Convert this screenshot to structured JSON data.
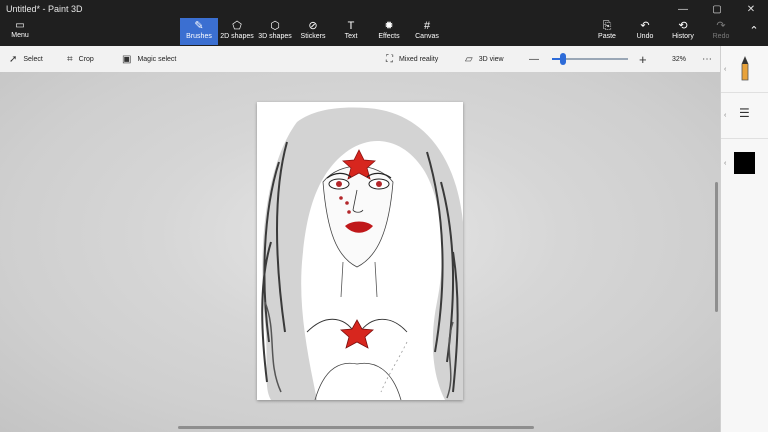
{
  "window": {
    "title": "Untitled* - Paint 3D",
    "controls": {
      "minimize": "—",
      "maximize": "▢",
      "close": "✕"
    }
  },
  "ribbon": {
    "menu_label": "Menu",
    "tools": [
      {
        "label": "Brushes",
        "icon": "brush-icon",
        "glyph": "✎",
        "active": true
      },
      {
        "label": "2D shapes",
        "icon": "2d-shapes-icon",
        "glyph": "⬠",
        "active": false
      },
      {
        "label": "3D shapes",
        "icon": "3d-shapes-icon",
        "glyph": "⬡",
        "active": false
      },
      {
        "label": "Stickers",
        "icon": "stickers-icon",
        "glyph": "⊘",
        "active": false
      },
      {
        "label": "Text",
        "icon": "text-icon",
        "glyph": "T",
        "active": false
      },
      {
        "label": "Effects",
        "icon": "effects-icon",
        "glyph": "✹",
        "active": false
      },
      {
        "label": "Canvas",
        "icon": "canvas-icon",
        "glyph": "#",
        "active": false
      }
    ],
    "actions": [
      {
        "label": "Paste",
        "icon": "paste-icon",
        "glyph": "📋",
        "enabled": true
      },
      {
        "label": "Undo",
        "icon": "undo-icon",
        "glyph": "↶",
        "enabled": true
      },
      {
        "label": "History",
        "icon": "history-icon",
        "glyph": "⟲",
        "enabled": true
      },
      {
        "label": "Redo",
        "icon": "redo-icon",
        "glyph": "↷",
        "enabled": false
      }
    ],
    "collapse_glyph": "⌃"
  },
  "toolbar": {
    "select_label": "Select",
    "crop_label": "Crop",
    "magic_select_label": "Magic select",
    "mixed_reality_label": "Mixed reality",
    "view_3d_label": "3D view",
    "zoom_out_glyph": "—",
    "zoom_in_glyph": "+",
    "zoom_value": "32%",
    "zoom_fraction": 0.14,
    "more_glyph": "⋯"
  },
  "side_panel": {
    "brush_icon": "marker-icon",
    "settings_icon": "sliders-icon",
    "selected_color": "#000000"
  },
  "colors": {
    "accent": "#3b6fd1",
    "star_red": "#d7261e",
    "lips_red": "#c0181a"
  }
}
